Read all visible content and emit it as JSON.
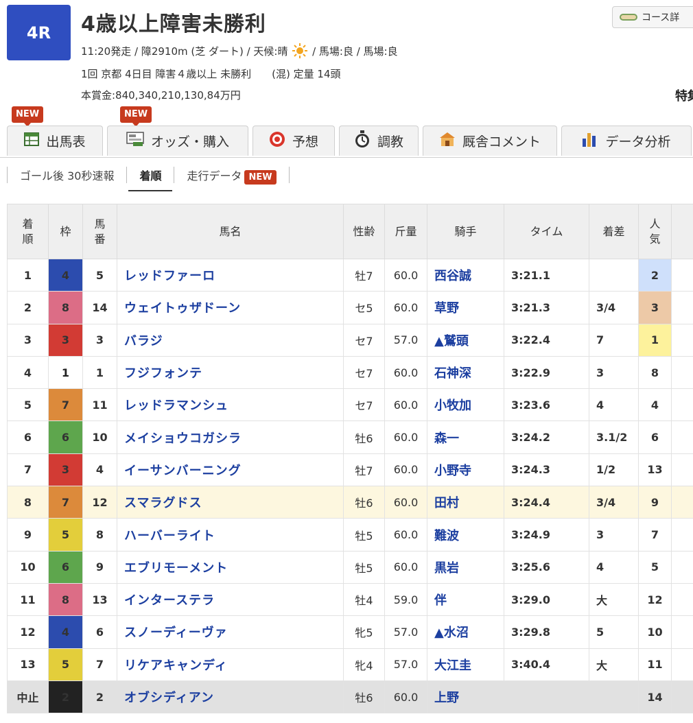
{
  "race": {
    "number": "4R",
    "title": "4歳以上障害未勝利",
    "line1_pre": "11:20発走 / 障2910m (芝 ダート) / 天候:晴",
    "line1_post": "/ 馬場:良 / 馬場:良",
    "line2": "1回 京都 4日目 障害４歳以上 未勝利　　(混) 定量 14頭",
    "line3": "本賞金:840,340,210,130,84万円",
    "course_button": "コース詳",
    "side_text": "特集"
  },
  "tabs": {
    "new_label": "NEW",
    "items": [
      {
        "label": "出馬表"
      },
      {
        "label": "オッズ・購入"
      },
      {
        "label": "予想"
      },
      {
        "label": "調教"
      },
      {
        "label": "厩舎コメント"
      },
      {
        "label": "データ分析"
      }
    ]
  },
  "subnav": {
    "items": [
      {
        "label": "ゴール後 30秒速報"
      },
      {
        "label": "着順"
      },
      {
        "label": "走行データ"
      }
    ],
    "new_label": "NEW"
  },
  "table": {
    "headers": {
      "rank": "着順",
      "waku": "枠",
      "umaban": "馬番",
      "name": "馬名",
      "sexage": "性齢",
      "weight": "斤量",
      "jockey": "騎手",
      "time": "タイム",
      "margin": "着差",
      "pop": "人気"
    },
    "rows": [
      {
        "rank": "1",
        "waku": "4",
        "umaban": "5",
        "name": "レッドファーロ",
        "sexage": "牡7",
        "weight": "60.0",
        "jockey": "西谷誠",
        "time": "3:21.1",
        "margin": "",
        "pop": "2"
      },
      {
        "rank": "2",
        "waku": "8",
        "umaban": "14",
        "name": "ウェイトゥザドーン",
        "sexage": "セ5",
        "weight": "60.0",
        "jockey": "草野",
        "time": "3:21.3",
        "margin": "3/4",
        "pop": "3"
      },
      {
        "rank": "3",
        "waku": "3",
        "umaban": "3",
        "name": "バラジ",
        "sexage": "セ7",
        "weight": "57.0",
        "jockey": "▲鷲頭",
        "time": "3:22.4",
        "margin": "7",
        "pop": "1"
      },
      {
        "rank": "4",
        "waku": "1",
        "umaban": "1",
        "name": "フジフォンテ",
        "sexage": "セ7",
        "weight": "60.0",
        "jockey": "石神深",
        "time": "3:22.9",
        "margin": "3",
        "pop": "8"
      },
      {
        "rank": "5",
        "waku": "7",
        "umaban": "11",
        "name": "レッドラマンシュ",
        "sexage": "セ7",
        "weight": "60.0",
        "jockey": "小牧加",
        "time": "3:23.6",
        "margin": "4",
        "pop": "4"
      },
      {
        "rank": "6",
        "waku": "6",
        "umaban": "10",
        "name": "メイショウコガシラ",
        "sexage": "牡6",
        "weight": "60.0",
        "jockey": "森一",
        "time": "3:24.2",
        "margin": "3.1/2",
        "pop": "6"
      },
      {
        "rank": "7",
        "waku": "3",
        "umaban": "4",
        "name": "イーサンバーニング",
        "sexage": "牡7",
        "weight": "60.0",
        "jockey": "小野寺",
        "time": "3:24.3",
        "margin": "1/2",
        "pop": "13"
      },
      {
        "rank": "8",
        "waku": "7",
        "umaban": "12",
        "name": "スマラグドス",
        "sexage": "牡6",
        "weight": "60.0",
        "jockey": "田村",
        "time": "3:24.4",
        "margin": "3/4",
        "pop": "9"
      },
      {
        "rank": "9",
        "waku": "5",
        "umaban": "8",
        "name": "ハーバーライト",
        "sexage": "牡5",
        "weight": "60.0",
        "jockey": "難波",
        "time": "3:24.9",
        "margin": "3",
        "pop": "7"
      },
      {
        "rank": "10",
        "waku": "6",
        "umaban": "9",
        "name": "エブリモーメント",
        "sexage": "牡5",
        "weight": "60.0",
        "jockey": "黒岩",
        "time": "3:25.6",
        "margin": "4",
        "pop": "5"
      },
      {
        "rank": "11",
        "waku": "8",
        "umaban": "13",
        "name": "インターステラ",
        "sexage": "牡4",
        "weight": "59.0",
        "jockey": "伴",
        "time": "3:29.0",
        "margin": "大",
        "pop": "12"
      },
      {
        "rank": "12",
        "waku": "4",
        "umaban": "6",
        "name": "スノーディーヴァ",
        "sexage": "牝5",
        "weight": "57.0",
        "jockey": "▲水沼",
        "time": "3:29.8",
        "margin": "5",
        "pop": "10"
      },
      {
        "rank": "13",
        "waku": "5",
        "umaban": "7",
        "name": "リケアキャンディ",
        "sexage": "牝4",
        "weight": "57.0",
        "jockey": "大江圭",
        "time": "3:40.4",
        "margin": "大",
        "pop": "11"
      },
      {
        "rank": "中止",
        "waku": "2",
        "umaban": "2",
        "name": "オブシディアン",
        "sexage": "牡6",
        "weight": "60.0",
        "jockey": "上野",
        "time": "",
        "margin": "",
        "pop": "14"
      }
    ]
  },
  "colors": {
    "race_badge": "#2f4ec0",
    "new_flag": "#c73a1e",
    "link": "#1c3fa0",
    "highlight_row": "#fdf7df"
  }
}
